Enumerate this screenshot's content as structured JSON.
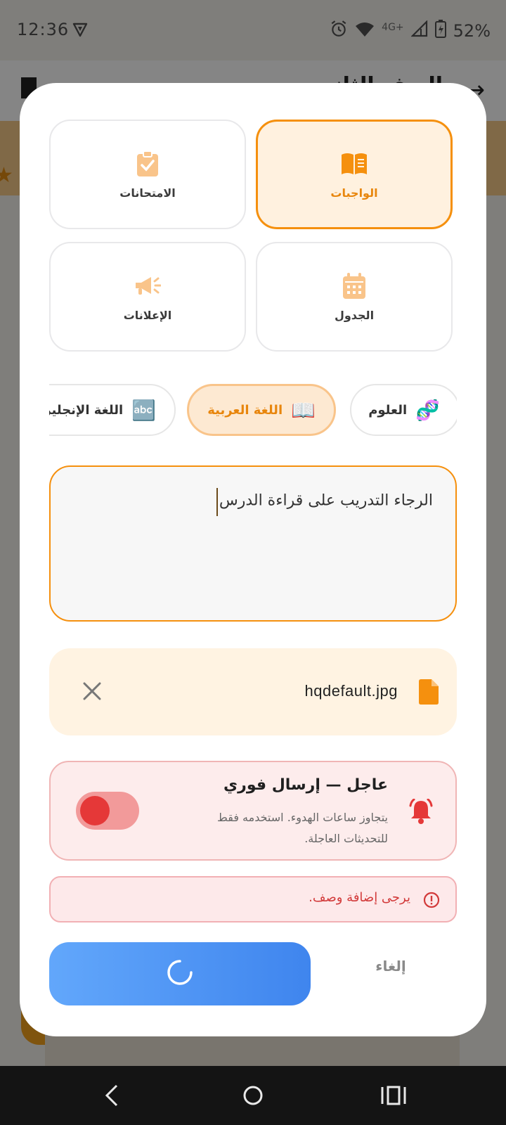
{
  "status_bar": {
    "time": "12:36",
    "network": "4G+",
    "battery": "52%"
  },
  "background": {
    "title": "الصف الثاني"
  },
  "dialog": {
    "categories": [
      {
        "label": "الواجبات",
        "icon": "book-open-icon",
        "selected": true
      },
      {
        "label": "الامتحانات",
        "icon": "clipboard-check-icon",
        "selected": false
      },
      {
        "label": "الجدول",
        "icon": "calendar-icon",
        "selected": false
      },
      {
        "label": "الإعلانات",
        "icon": "megaphone-icon",
        "selected": false
      }
    ],
    "subjects": [
      {
        "label": "العلوم",
        "emoji": "🧬",
        "selected": false
      },
      {
        "label": "اللغة العربية",
        "emoji": "📖",
        "selected": true
      },
      {
        "label": "اللغة الإنجليزية",
        "emoji": "🔤",
        "selected": false
      }
    ],
    "description": {
      "value": "الرجاء التدريب على قراءة الدرس"
    },
    "attachment": {
      "file_name": "hqdefault.jpg"
    },
    "urgent": {
      "title": "عاجل — إرسال فوري",
      "subtitle": "يتجاوز ساعات الهدوء. استخدمه فقط للتحديثات العاجلة.",
      "enabled": false
    },
    "error": {
      "message": "يرجى إضافة وصف."
    },
    "actions": {
      "cancel_label": "إلغاء",
      "submit_loading": true
    }
  },
  "colors": {
    "accent": "#f5900e",
    "primary": "#3f85ee",
    "danger": "#e53838"
  }
}
